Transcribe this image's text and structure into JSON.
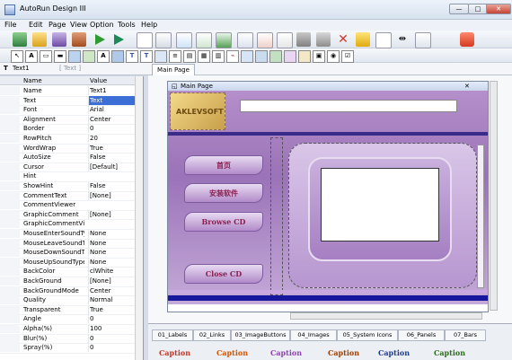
{
  "window": {
    "title": "AutoRun Design III",
    "min_label": "—",
    "max_label": "□",
    "close_label": "✕"
  },
  "menu": [
    "File",
    "Edit",
    "Page",
    "View",
    "Option",
    "Tools",
    "Help"
  ],
  "left_panel": {
    "tab_title": "Text1",
    "tab_type": "[ Text ]"
  },
  "grid": {
    "header_name": "Name",
    "header_value": "Value",
    "rows": [
      {
        "name": "Name",
        "value": "Text1"
      },
      {
        "name": "Text",
        "value": "Text"
      },
      {
        "name": "Font",
        "value": "Arial"
      },
      {
        "name": "Alignment",
        "value": "Center"
      },
      {
        "name": "Border",
        "value": "0"
      },
      {
        "name": "RowPitch",
        "value": "20"
      },
      {
        "name": "WordWrap",
        "value": "True"
      },
      {
        "name": "AutoSize",
        "value": "False"
      },
      {
        "name": "Cursor",
        "value": "[Default]"
      },
      {
        "name": "Hint",
        "value": ""
      },
      {
        "name": "ShowHint",
        "value": "False"
      },
      {
        "name": "CommentText",
        "value": "[None]"
      },
      {
        "name": "CommentViewer",
        "value": ""
      },
      {
        "name": "GraphicComment",
        "value": "[None]"
      },
      {
        "name": "GraphicCommentViewer",
        "value": ""
      },
      {
        "name": "MouseEnterSoundType",
        "value": "None"
      },
      {
        "name": "MouseLeaveSoundType",
        "value": "None"
      },
      {
        "name": "MouseDownSoundType",
        "value": "None"
      },
      {
        "name": "MouseUpSoundType",
        "value": "None"
      },
      {
        "name": "BackColor",
        "value": "clWhite"
      },
      {
        "name": "BackGround",
        "value": "[None]"
      },
      {
        "name": "BackGroundMode",
        "value": "Center"
      },
      {
        "name": "Quality",
        "value": "Normal"
      },
      {
        "name": "Transparent",
        "value": "True"
      },
      {
        "name": "Angle",
        "value": "0"
      },
      {
        "name": "Alpha(%)",
        "value": "100"
      },
      {
        "name": "Blur(%)",
        "value": "0"
      },
      {
        "name": "Spray(%)",
        "value": "0"
      }
    ]
  },
  "main_tab": {
    "label": "Main Page"
  },
  "page": {
    "caption": "Main Page",
    "logo_text": "AKLEVSOFT",
    "buttons": [
      "首页",
      "安装软件",
      "Browse CD",
      "Close CD"
    ]
  },
  "bottom_tabs": [
    "01_Labels",
    "02_Links",
    "03_ImageButtons",
    "04_Images",
    "05_System Icons",
    "06_Panels",
    "07_Bars"
  ],
  "caption_sample": "Caption",
  "colors": {
    "accent": "#4a6fa5",
    "page_purple": "#a67fc3",
    "caption_red": "#c0392b"
  }
}
